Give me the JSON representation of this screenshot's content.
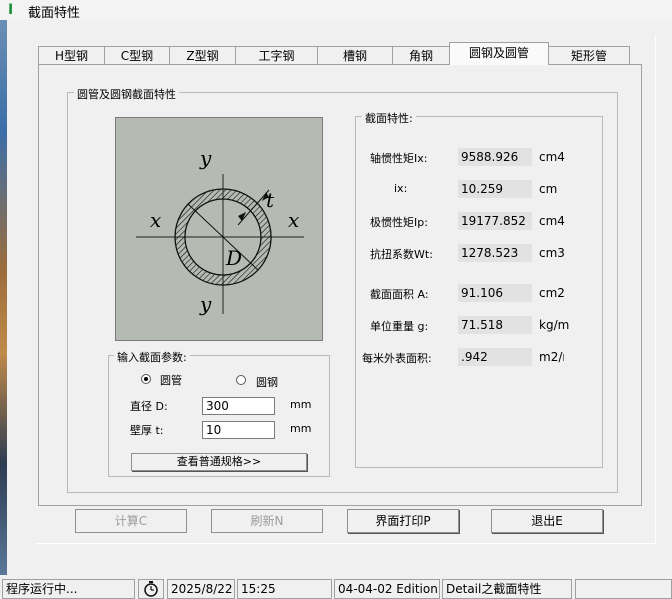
{
  "window": {
    "title": "截面特性",
    "app_icon_glyph": "I"
  },
  "tabs": [
    "H型钢",
    "C型钢",
    "Z型钢",
    "工字钢",
    "槽钢",
    "角钢",
    "圆钢及圆管",
    "矩形管"
  ],
  "active_tab": "圆钢及圆管",
  "main_group": {
    "title": "圆管及圆钢截面特性"
  },
  "diagram": {
    "y_top": "y",
    "y_bottom": "y",
    "x_left": "x",
    "x_right": "x",
    "t": "t",
    "D": "D"
  },
  "input_group": {
    "title": "输入截面参数:",
    "radio_tube": "圆管",
    "radio_round": "圆钢",
    "diameter_label": "直径 D:",
    "diameter_value": "300",
    "diameter_unit": "mm",
    "thickness_label": "壁厚 t:",
    "thickness_value": "10",
    "thickness_unit": "mm",
    "spec_button": "查看普通规格>>"
  },
  "props_group": {
    "title": "截面特性:",
    "rows": [
      {
        "label": "轴惯性矩Ix:",
        "value": "9588.926",
        "unit": "cm4"
      },
      {
        "label": "ix:",
        "value": "10.259",
        "unit": "cm"
      },
      {
        "label": "极惯性矩Ip:",
        "value": "19177.852",
        "unit": "cm4"
      },
      {
        "label": "抗扭系数Wt:",
        "value": "1278.523",
        "unit": "cm3"
      },
      {
        "label": "截面面积 A:",
        "value": "91.106",
        "unit": "cm2"
      },
      {
        "label": "单位重量 g:",
        "value": "71.518",
        "unit": "kg/m"
      },
      {
        "label": "每米外表面积:",
        "value": ".942",
        "unit": "m2/m"
      }
    ]
  },
  "buttons": {
    "calc": "计算C",
    "refresh": "刷新N",
    "print": "界面打印P",
    "exit": "退出E"
  },
  "status": {
    "state": "程序运行中...",
    "date": "2025/8/22",
    "time": "15:25",
    "edition": "04-04-02 Edition",
    "detail": "Detail之截面特性"
  }
}
